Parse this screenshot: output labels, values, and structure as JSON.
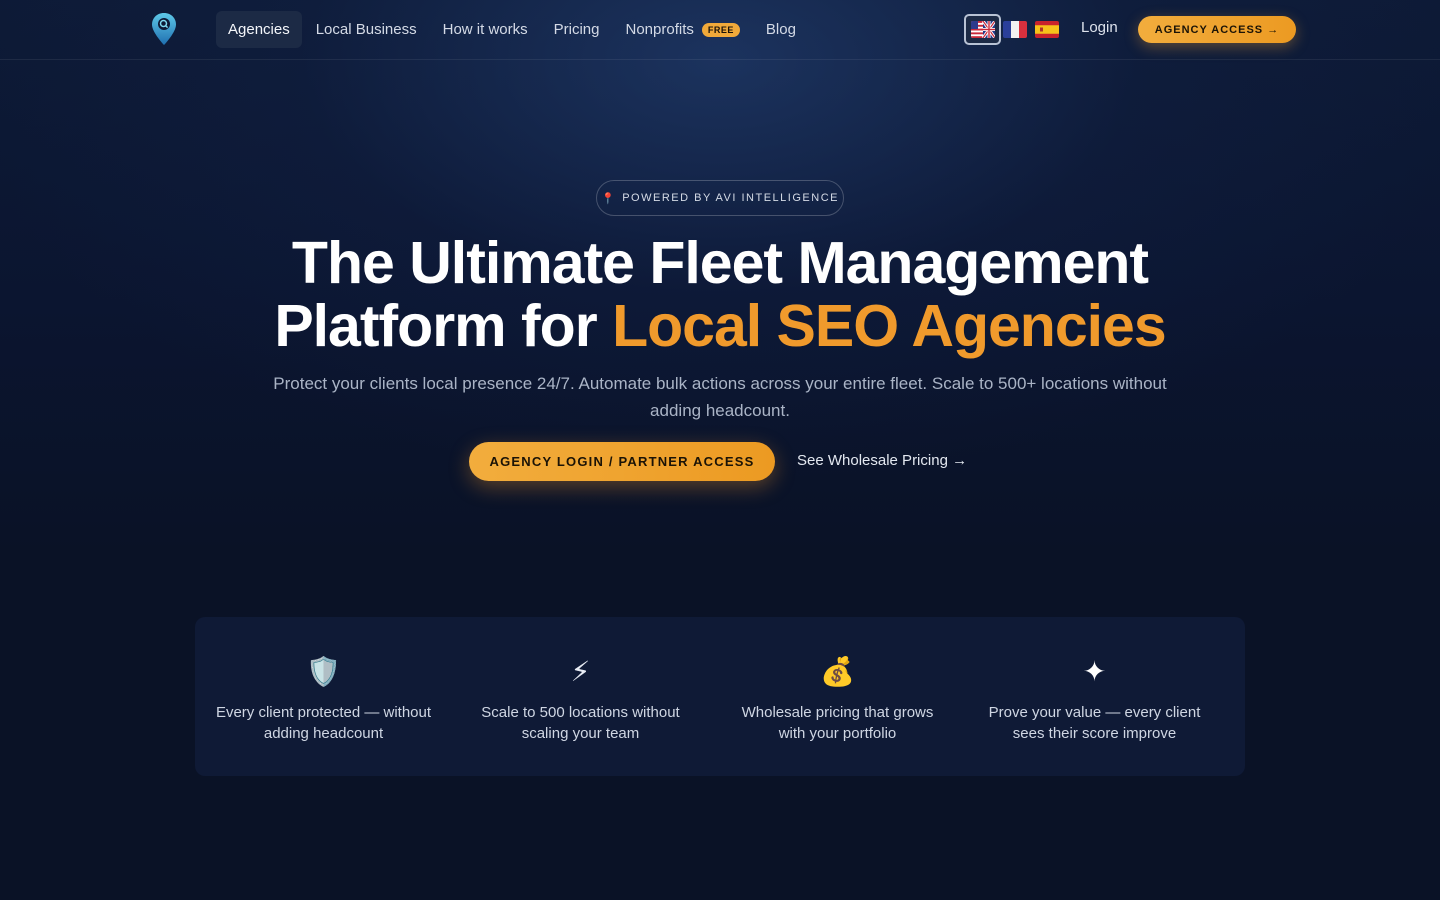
{
  "nav": {
    "links": [
      {
        "label": "Agencies",
        "active": true
      },
      {
        "label": "Local Business"
      },
      {
        "label": "How it works"
      },
      {
        "label": "Pricing"
      },
      {
        "label": "Nonprofits",
        "badge": "FREE"
      },
      {
        "label": "Blog"
      }
    ],
    "languages": [
      "en",
      "fr",
      "es"
    ],
    "active_language": "en",
    "login": "Login",
    "cta": "AGENCY ACCESS →"
  },
  "hero": {
    "pill": "POWERED BY AVI INTELLIGENCE",
    "pill_icon": "pin-icon",
    "headline_part1": "The Ultimate Fleet Management Platform for ",
    "headline_accent": "Local SEO Agencies",
    "subhead": "Protect your clients local presence 24/7. Automate bulk actions across your entire fleet. Scale to 500+ locations without adding headcount.",
    "primary_cta": "AGENCY LOGIN / PARTNER ACCESS",
    "secondary_cta": "See Wholesale Pricing →"
  },
  "features": [
    {
      "icon": "shield-icon",
      "glyph": "🛡️",
      "text": "Every client protected — without adding headcount"
    },
    {
      "icon": "lightning-icon",
      "glyph": "⚡",
      "text": "Scale to 500 locations without scaling your team"
    },
    {
      "icon": "money-bag-icon",
      "glyph": "💰",
      "text": "Wholesale pricing that grows with your portfolio"
    },
    {
      "icon": "sparkle-icon",
      "glyph": "✦",
      "text": "Prove your value — every client sees their score improve"
    }
  ],
  "colors": {
    "accent": "#f09a2c",
    "background": "#0a1226",
    "button": "#f2ad3d"
  }
}
